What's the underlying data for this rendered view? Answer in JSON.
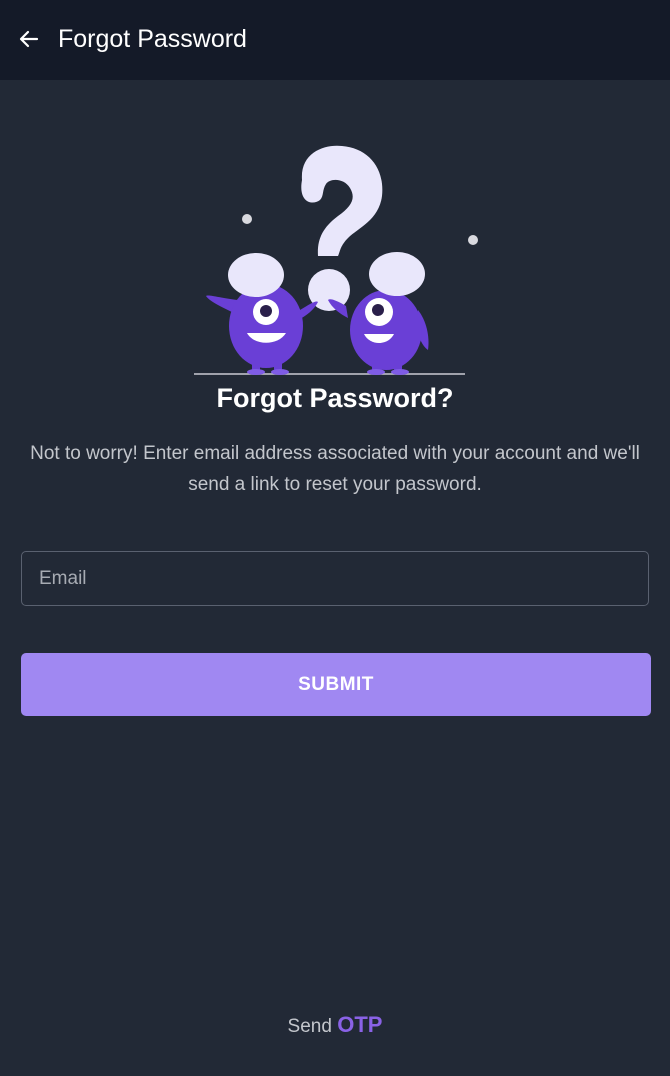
{
  "header": {
    "title": "Forgot Password",
    "back_icon": "arrow-left-icon"
  },
  "illustration": {
    "icon": "question-monsters-illustration",
    "accent": "#6a3fd6"
  },
  "main": {
    "heading": "Forgot Password?",
    "description": "Not to worry! Enter email address associated with your account and we'll send a link to reset your password.",
    "email_placeholder": "Email",
    "email_value": "",
    "submit_label": "SUBMIT"
  },
  "footer": {
    "prefix": "Send",
    "link_label": "OTP"
  },
  "colors": {
    "background": "#222936",
    "header_bg": "#141a28",
    "button": "#a088f2",
    "link": "#8a62e6"
  }
}
